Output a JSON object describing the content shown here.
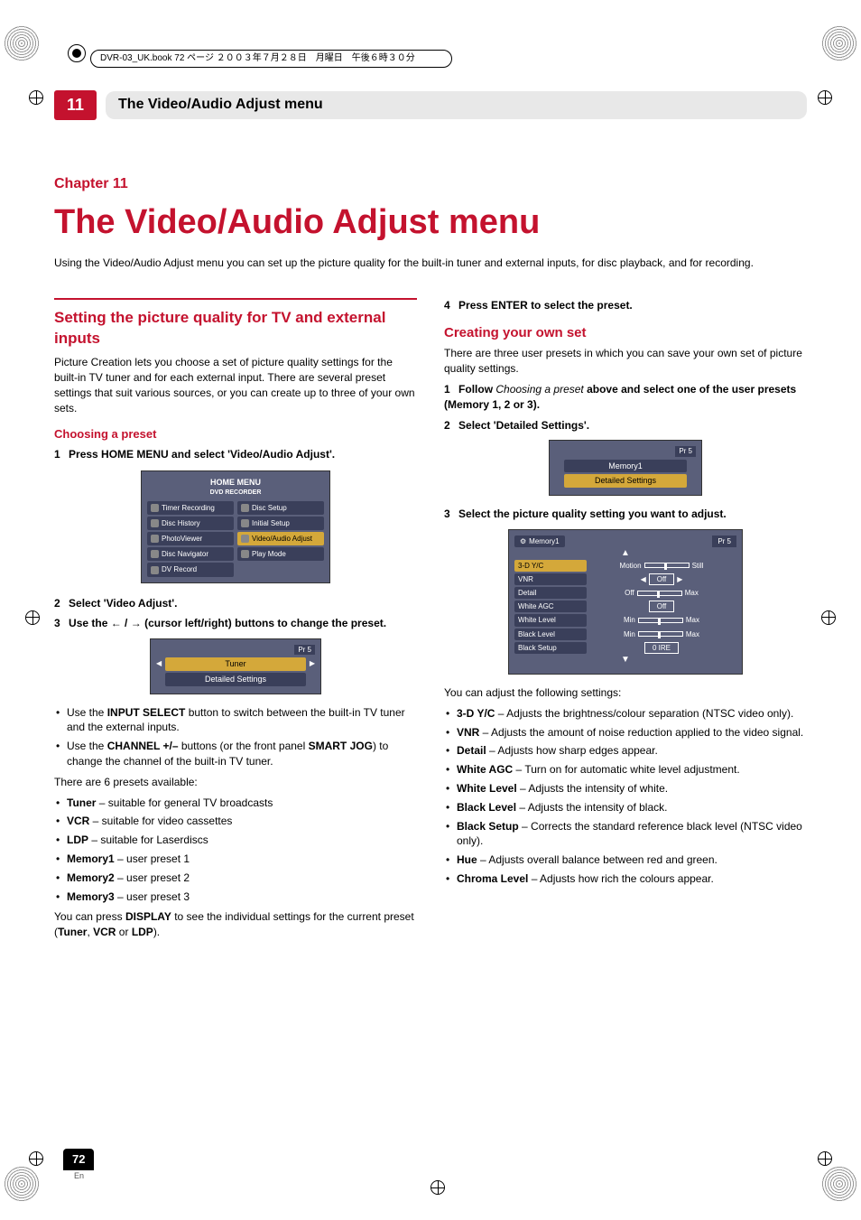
{
  "filename_header": "DVR-03_UK.book 72 ページ ２００３年７月２８日　月曜日　午後６時３０分",
  "chapter_number": "11",
  "header_title": "The Video/Audio Adjust menu",
  "chapter_label": "Chapter 11",
  "main_title": "The Video/Audio Adjust menu",
  "intro": "Using the Video/Audio Adjust menu you can set up the picture quality for the built-in tuner and external inputs, for disc playback, and for recording.",
  "left": {
    "section_title": "Setting the picture quality for TV and external inputs",
    "section_body": "Picture Creation lets you choose a set of picture quality settings for the built-in TV tuner and for each external input. There are several preset settings that suit various sources, or you can create up to three of your own sets.",
    "sub1_title": "Choosing a preset",
    "step1_num": "1",
    "step1_text": "Press HOME MENU and select 'Video/Audio Adjust'.",
    "home_menu": {
      "title": "HOME MENU",
      "subtitle": "DVD RECORDER",
      "left_items": [
        "Timer Recording",
        "Disc History",
        "PhotoViewer",
        "Disc Navigator",
        "DV Record"
      ],
      "right_items": [
        "Disc Setup",
        "Initial Setup",
        "Video/Audio Adjust",
        "Play Mode"
      ]
    },
    "step2_num": "2",
    "step2_text": "Select 'Video Adjust'.",
    "step3_num": "3",
    "step3_text_pre": "Use the ",
    "step3_icons": "← / →",
    "step3_text_post": " (cursor left/right) buttons to change the preset.",
    "preset_box": {
      "badge": "Pr 5",
      "row1": "Tuner",
      "row2": "Detailed Settings"
    },
    "bullets1": [
      {
        "pre": "Use the ",
        "bold": "INPUT SELECT",
        "post": " button to switch between the built-in TV tuner and the external inputs."
      },
      {
        "pre": "Use the ",
        "bold": "CHANNEL +/–",
        "post": " buttons (or the front panel ",
        "bold2": "SMART JOG",
        "post2": ") to change the channel of the built-in TV tuner."
      }
    ],
    "presets_intro": "There are 6 presets available:",
    "presets": [
      {
        "bold": "Tuner",
        "desc": " – suitable for general TV broadcasts"
      },
      {
        "bold": "VCR",
        "desc": " – suitable for video cassettes"
      },
      {
        "bold": "LDP",
        "desc": " – suitable for Laserdiscs"
      },
      {
        "bold": "Memory1",
        "desc": " – user preset 1"
      },
      {
        "bold": "Memory2",
        "desc": " – user preset 2"
      },
      {
        "bold": "Memory3",
        "desc": " – user preset 3"
      }
    ],
    "display_note_pre": "You can press ",
    "display_note_bold": "DISPLAY",
    "display_note_mid": " to see the individual settings for the current preset (",
    "display_note_b1": "Tuner",
    "display_note_c1": ", ",
    "display_note_b2": "VCR",
    "display_note_c2": " or ",
    "display_note_b3": "LDP",
    "display_note_end": ")."
  },
  "right": {
    "step4_num": "4",
    "step4_text": "Press ENTER to select the preset.",
    "sub2_title": "Creating your own set",
    "sub2_body": "There are three user presets in which you can save your own set of picture quality settings.",
    "step1_num": "1",
    "step1_pre": "Follow ",
    "step1_italic": "Choosing a preset",
    "step1_post": " above and select one of the user presets (Memory 1, 2 or 3).",
    "step2_num": "2",
    "step2_text": "Select 'Detailed Settings'.",
    "mem_box": {
      "badge": "Pr 5",
      "row1": "Memory1",
      "row2": "Detailed Settings"
    },
    "step3_num": "3",
    "step3_text": "Select the picture quality setting you want to adjust.",
    "settings": {
      "mem": "Memory1",
      "pr": "Pr 5",
      "rows": [
        {
          "label": "3-D Y/C",
          "left": "Motion",
          "right": "Still",
          "type": "slider"
        },
        {
          "label": "VNR",
          "val": "Off",
          "type": "box-arrows"
        },
        {
          "label": "Detail",
          "left": "Off",
          "right": "Max",
          "type": "slider"
        },
        {
          "label": "White AGC",
          "val": "Off",
          "type": "box"
        },
        {
          "label": "White Level",
          "left": "Min",
          "right": "Max",
          "type": "slider"
        },
        {
          "label": "Black Level",
          "left": "Min",
          "right": "Max",
          "type": "slider"
        },
        {
          "label": "Black Setup",
          "val": "0 IRE",
          "type": "box"
        }
      ]
    },
    "adjust_intro": "You can adjust the following settings:",
    "adjust_list": [
      {
        "bold": "3-D Y/C",
        "desc": " – Adjusts the brightness/colour separation (NTSC video only)."
      },
      {
        "bold": "VNR",
        "desc": " – Adjusts the amount of noise reduction applied to the video signal."
      },
      {
        "bold": "Detail",
        "desc": " – Adjusts how sharp edges appear."
      },
      {
        "bold": "White AGC",
        "desc": " – Turn on for automatic white level adjustment."
      },
      {
        "bold": "White Level",
        "desc": " – Adjusts the intensity of white."
      },
      {
        "bold": "Black Level",
        "desc": " – Adjusts the intensity of black."
      },
      {
        "bold": "Black Setup",
        "desc": " – Corrects the standard reference black level (NTSC video only)."
      },
      {
        "bold": "Hue",
        "desc": " – Adjusts overall balance between red and green."
      },
      {
        "bold": "Chroma Level",
        "desc": " – Adjusts how rich the colours appear."
      }
    ]
  },
  "page_number": "72",
  "page_lang": "En"
}
